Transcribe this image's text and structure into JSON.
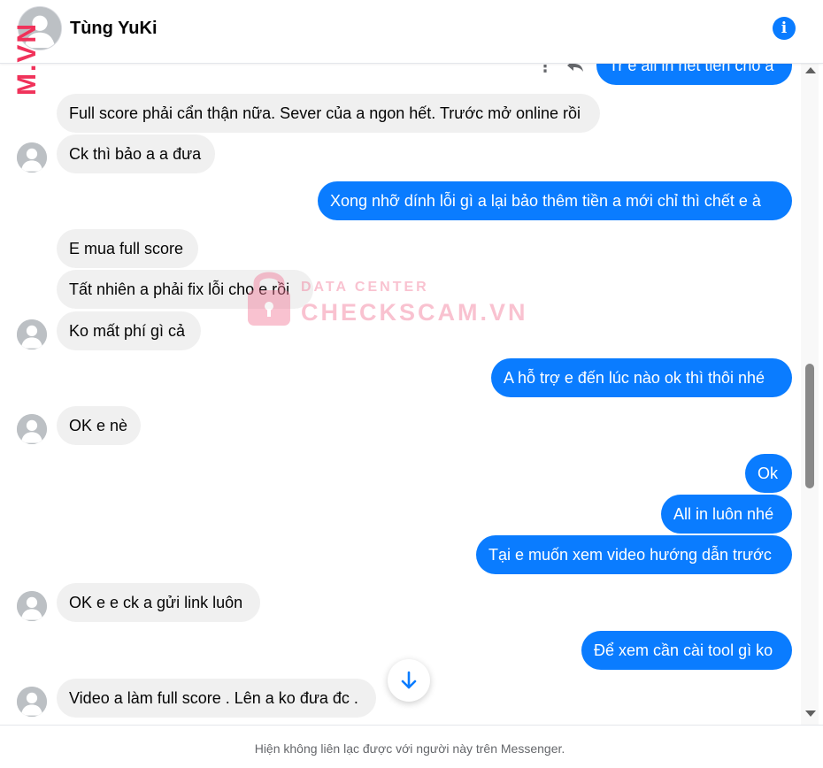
{
  "header": {
    "contact_name": "Tùng YuKi",
    "info_symbol": "i",
    "brand_mark": "M.VN"
  },
  "messages": [
    {
      "dir": "out",
      "text": "Tr e all in hết tiền cho a"
    },
    {
      "dir": "in",
      "text": "Full score phải cẩn thận nữa. Sever của a ngon hết. Trước mở online rồi"
    },
    {
      "dir": "in",
      "text": "Ck thì bảo a a đưa"
    },
    {
      "dir": "out",
      "text": "Xong nhỡ dính lỗi gì a lại bảo thêm tiền a mới chỉ thì chết e à"
    },
    {
      "dir": "in",
      "text": "E mua full score"
    },
    {
      "dir": "in",
      "text": "Tất nhiên a phải fix lỗi cho e rồi"
    },
    {
      "dir": "in",
      "text": "Ko mất phí gì cả"
    },
    {
      "dir": "out",
      "text": "A hỗ trợ e đến lúc nào ok thì thôi nhé"
    },
    {
      "dir": "in",
      "text": "OK e nè"
    },
    {
      "dir": "out",
      "text": "Ok"
    },
    {
      "dir": "out",
      "text": "All in luôn nhé"
    },
    {
      "dir": "out",
      "text": "Tại e muốn xem video hướng dẫn trước"
    },
    {
      "dir": "in",
      "text": "OK e e ck a gửi link luôn"
    },
    {
      "dir": "out",
      "text": "Để xem cần cài tool gì ko"
    },
    {
      "dir": "in",
      "text": "Video a làm full score . Lên a ko đưa đc ."
    }
  ],
  "toolbar": {
    "more_symbol": "⋮"
  },
  "watermark": {
    "line1": "DATA CENTER",
    "line2": "CHECKSCAM.VN"
  },
  "footer": {
    "note": "Hiện không liên lạc được với người này trên Messenger."
  },
  "colors": {
    "outgoing_bubble": "#0a7cff",
    "incoming_bubble": "#f0f0f0",
    "watermark": "#f27a98"
  }
}
